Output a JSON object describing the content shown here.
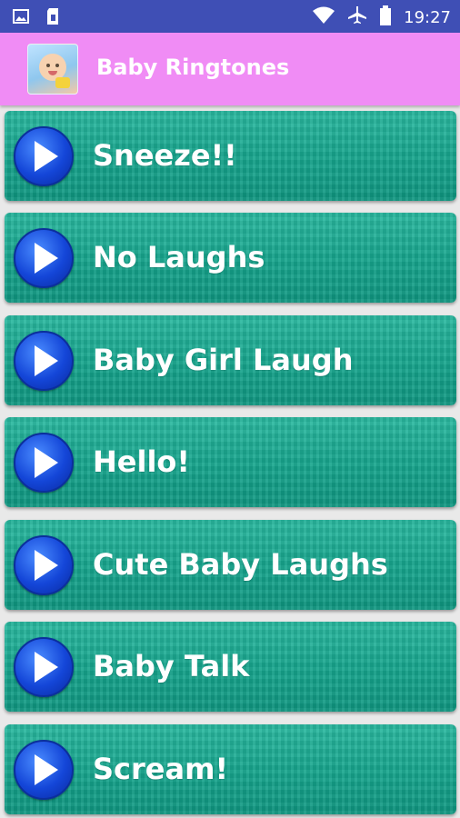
{
  "status_bar": {
    "time": "19:27",
    "icons": [
      "image-icon",
      "sim-card-icon",
      "wifi-icon",
      "airplane-icon",
      "battery-icon"
    ]
  },
  "app_bar": {
    "title": "Baby Ringtones",
    "color": "#f08cf5"
  },
  "ringtones": [
    {
      "label": "Sneeze!!"
    },
    {
      "label": "No Laughs"
    },
    {
      "label": "Baby Girl Laugh"
    },
    {
      "label": "Hello!"
    },
    {
      "label": "Cute Baby Laughs"
    },
    {
      "label": "Baby Talk"
    },
    {
      "label": "Scream!"
    }
  ],
  "colors": {
    "status_bar": "#3f4fb5",
    "item_background": "#17a68e",
    "play_button": "#1446d8"
  }
}
